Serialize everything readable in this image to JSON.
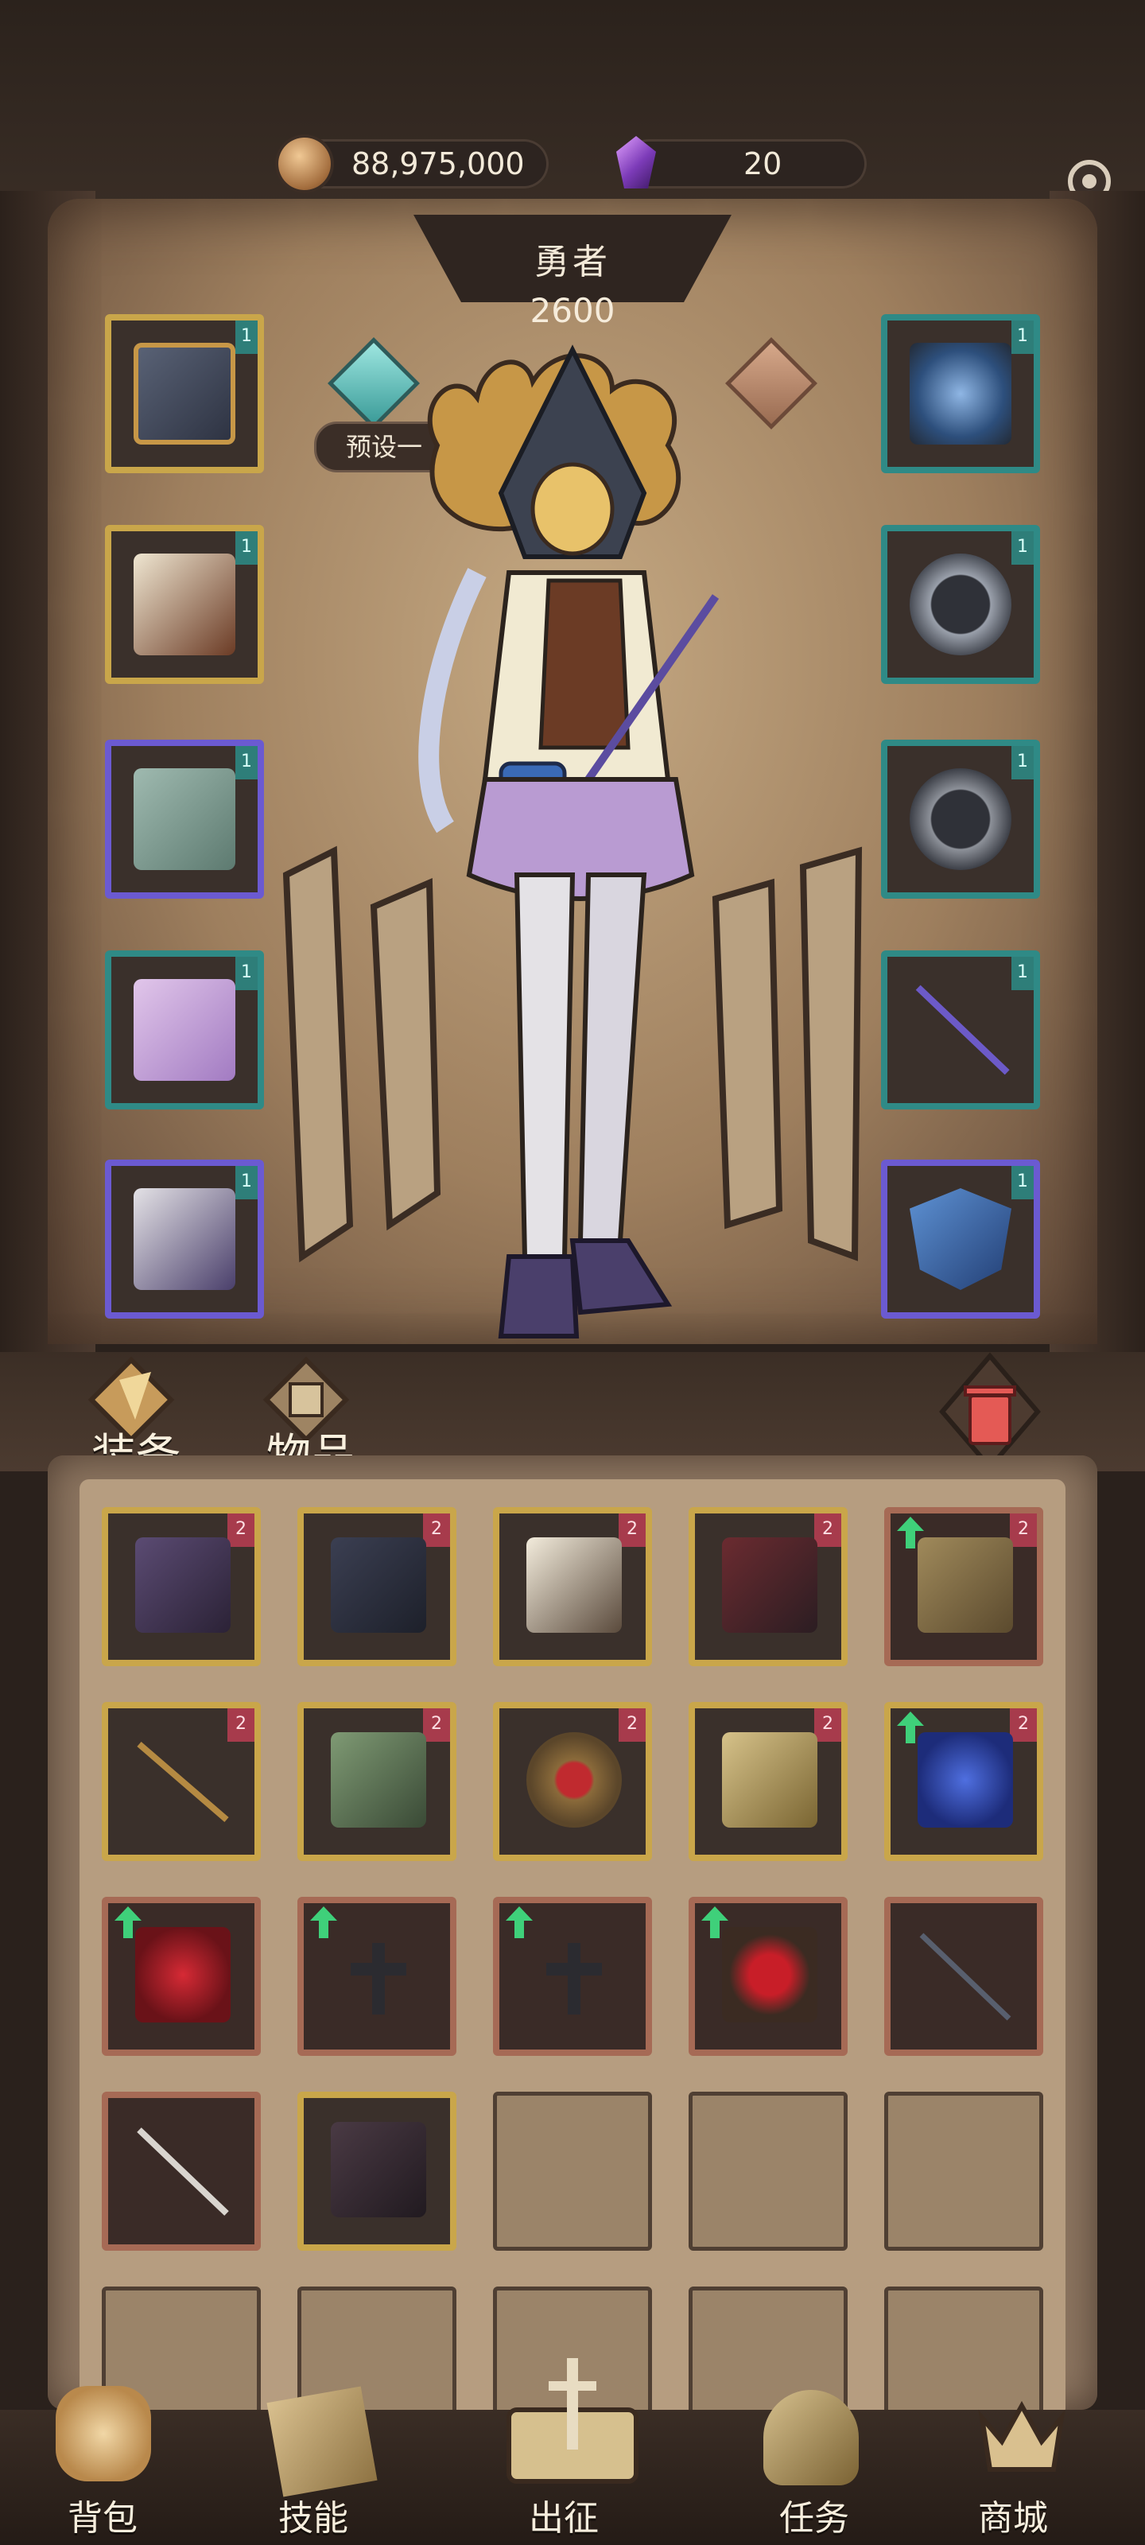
{
  "currency": {
    "gold": "88,975,000",
    "gems": "20"
  },
  "hero": {
    "title": "勇者",
    "power": "2600",
    "preset_label": "预设一"
  },
  "equipment": {
    "left": [
      {
        "name": "hood",
        "frame": "gold",
        "level": "1"
      },
      {
        "name": "armor",
        "frame": "gold",
        "level": "1"
      },
      {
        "name": "gauntlet",
        "frame": "purple",
        "level": "1"
      },
      {
        "name": "pants",
        "frame": "teal",
        "level": "1"
      },
      {
        "name": "boots",
        "frame": "purple",
        "level": "1"
      }
    ],
    "right": [
      {
        "name": "necklace",
        "frame": "teal",
        "level": "1"
      },
      {
        "name": "ring-1",
        "frame": "teal",
        "level": "1"
      },
      {
        "name": "ring-2",
        "frame": "teal",
        "level": "1"
      },
      {
        "name": "wand",
        "frame": "teal",
        "level": "1"
      },
      {
        "name": "shield",
        "frame": "purple",
        "level": "1"
      }
    ]
  },
  "bag": {
    "tabs": {
      "equipment": "装备",
      "items": "物品"
    },
    "items": [
      {
        "name": "lantern-helm",
        "frame": "gold",
        "tag": "2",
        "upgrade": false
      },
      {
        "name": "dark-dress",
        "frame": "gold",
        "tag": "2",
        "upgrade": false
      },
      {
        "name": "white-armor",
        "frame": "gold",
        "tag": "2",
        "upgrade": false
      },
      {
        "name": "red-cloak",
        "frame": "gold",
        "tag": "2",
        "upgrade": false
      },
      {
        "name": "leather-boots",
        "frame": "copper",
        "tag": "2",
        "upgrade": true
      },
      {
        "name": "long-spear",
        "frame": "gold",
        "tag": "2",
        "upgrade": false
      },
      {
        "name": "green-armor",
        "frame": "gold",
        "tag": "2",
        "upgrade": false
      },
      {
        "name": "ruby-ring",
        "frame": "gold",
        "tag": "2",
        "upgrade": false
      },
      {
        "name": "fist-gauntlet",
        "frame": "gold",
        "tag": "2",
        "upgrade": false
      },
      {
        "name": "heart-sapphire",
        "frame": "gold",
        "tag": "2",
        "upgrade": true
      },
      {
        "name": "heart-ruby-amulet",
        "frame": "copper",
        "tag": "",
        "upgrade": true
      },
      {
        "name": "cross-amulet-1",
        "frame": "copper",
        "tag": "",
        "upgrade": true
      },
      {
        "name": "cross-amulet-2",
        "frame": "copper",
        "tag": "",
        "upgrade": true
      },
      {
        "name": "ruby-pendant",
        "frame": "copper",
        "tag": "",
        "upgrade": true
      },
      {
        "name": "dark-spear",
        "frame": "copper",
        "tag": "",
        "upgrade": false
      },
      {
        "name": "bone-wand",
        "frame": "copper",
        "tag": "",
        "upgrade": false
      },
      {
        "name": "torn-cloak",
        "frame": "gold",
        "tag": "",
        "upgrade": false
      }
    ],
    "empty_slots": 8
  },
  "nav": [
    {
      "key": "bag",
      "label": "背包",
      "icon": "backpack-icon"
    },
    {
      "key": "skills",
      "label": "技能",
      "icon": "skill-book-icon"
    },
    {
      "key": "expedition",
      "label": "出征",
      "icon": "sword-map-icon"
    },
    {
      "key": "tasks",
      "label": "任务",
      "icon": "horn-icon"
    },
    {
      "key": "shop",
      "label": "商城",
      "icon": "crown-shop-icon"
    }
  ],
  "colors": {
    "gold_frame": "#c9a64a",
    "teal_frame": "#2f8a86",
    "purple_frame": "#6b5ad1",
    "copper_frame": "#a66a55",
    "upgrade_arrow": "#3fd07a",
    "tag_red": "#a73b4c"
  }
}
